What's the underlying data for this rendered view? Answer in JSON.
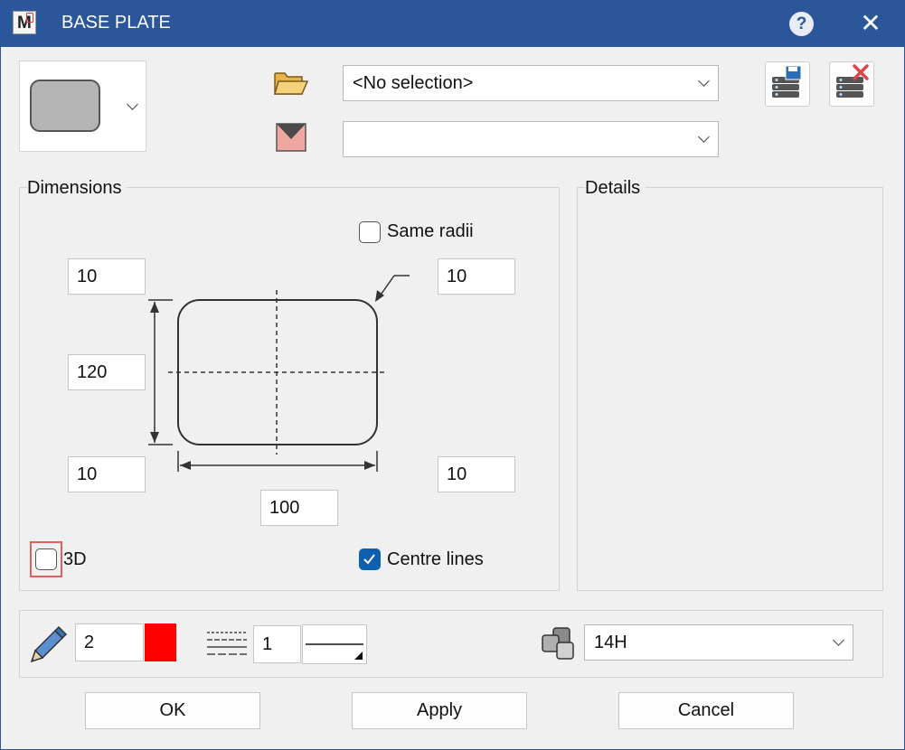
{
  "window": {
    "title": "BASE PLATE"
  },
  "header": {
    "library_select": {
      "value": "<No selection>"
    },
    "layer_select": {
      "value": ""
    }
  },
  "dimensions": {
    "title": "Dimensions",
    "same_radii_label": "Same radii",
    "same_radii_checked": false,
    "top_left_radius": "10",
    "top_right_radius": "10",
    "height": "120",
    "bottom_left_radius": "10",
    "bottom_right_radius": "10",
    "width": "100",
    "three_d_label": "3D",
    "three_d_checked": false,
    "centre_lines_label": "Centre lines",
    "centre_lines_checked": true
  },
  "details": {
    "title": "Details"
  },
  "properties": {
    "pen_value": "2",
    "pen_color": "#ff0000",
    "line_type_value": "1",
    "grouping_value": "14H"
  },
  "buttons": {
    "ok": "OK",
    "apply": "Apply",
    "cancel": "Cancel"
  },
  "icons": [
    "app-icon",
    "help-icon",
    "close-icon",
    "folder-open-icon",
    "layer-icon",
    "save-library-icon",
    "delete-library-icon",
    "pen-icon",
    "line-type-icon",
    "grouping-icon",
    "chevron-down-icon"
  ]
}
